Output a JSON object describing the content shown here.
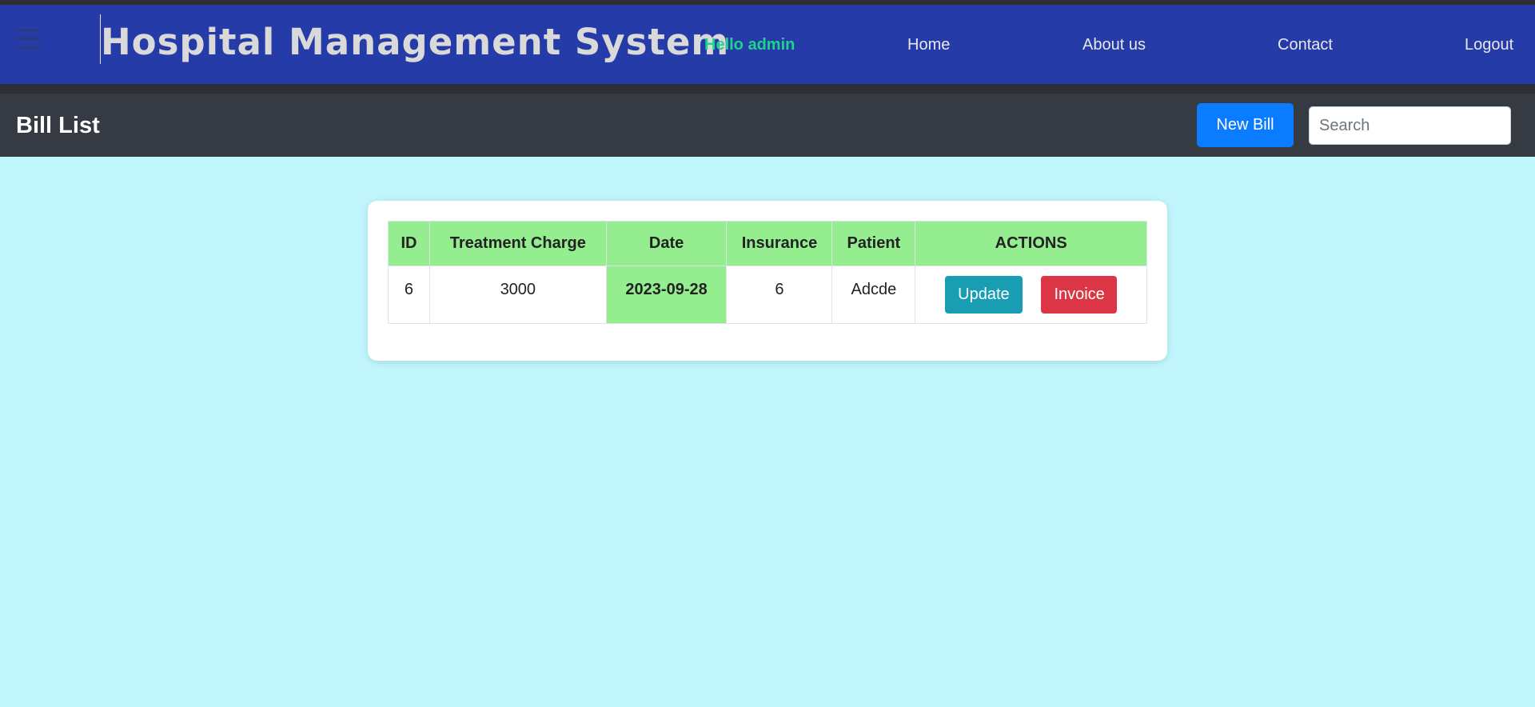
{
  "navbar": {
    "brand": "Hospital Management System",
    "greeting": "Hello admin",
    "links": [
      "Home",
      "About us",
      "Contact",
      "Logout"
    ]
  },
  "header": {
    "title": "Bill List",
    "new_button": "New Bill",
    "search_placeholder": "Search"
  },
  "table": {
    "columns": [
      "ID",
      "Treatment Charge",
      "Date",
      "Insurance",
      "Patient",
      "ACTIONS"
    ],
    "rows": [
      {
        "id": "6",
        "charge": "3000",
        "date": "2023-09-28",
        "insurance": "6",
        "patient": "Adcde"
      }
    ],
    "update_label": "Update",
    "invoice_label": "Invoice"
  },
  "colors": {
    "navbar": "#253ba8",
    "subheader": "#353a43",
    "background": "#c0f6fc",
    "table_header": "#94ee90",
    "primary": "#0b7bff",
    "info": "#189db3",
    "danger": "#dc3545",
    "greeting": "#1ed38a"
  }
}
